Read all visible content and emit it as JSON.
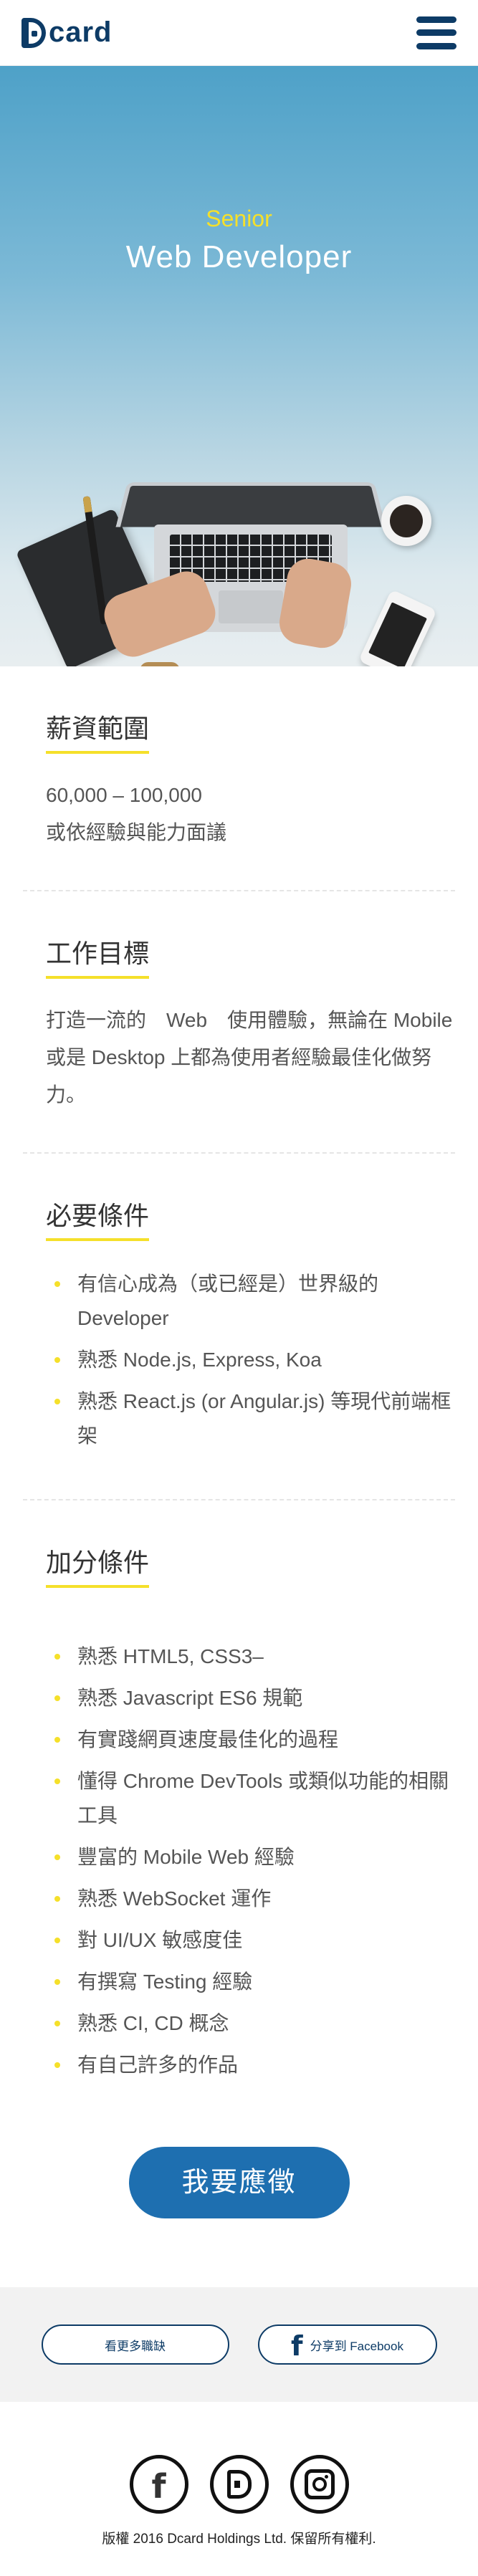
{
  "header": {
    "logo_text": "card",
    "menu_icon": "hamburger-menu-icon"
  },
  "hero": {
    "level": "Senior",
    "title": "Web Developer"
  },
  "salary": {
    "title": "薪資範圍",
    "range": "60,000 – 100,000",
    "note": "或依經驗與能力面議"
  },
  "goal": {
    "title": "工作目標",
    "text": "打造一流的　Web　使用體驗，無論在 Mobile 或是 Desktop 上都為使用者經驗最佳化做努力。"
  },
  "required": {
    "title": "必要條件",
    "items": [
      "有信心成為（或已經是）世界級的 Developer",
      "熟悉 Node.js, Express, Koa",
      "熟悉 React.js (or Angular.js) 等現代前端框架"
    ]
  },
  "bonus": {
    "title": "加分條件",
    "items": [
      "熟悉 HTML5, CSS3–",
      "熟悉 Javascript ES6 規範",
      "有實踐網頁速度最佳化的過程",
      "懂得 Chrome DevTools 或類似功能的相關工具",
      "豐富的 Mobile Web 經驗",
      "熟悉 WebSocket 運作",
      "對 UI/UX 敏感度佳",
      "有撰寫 Testing 經驗",
      "熟悉 CI, CD 概念",
      "有自己許多的作品"
    ]
  },
  "apply_label": "我要應徵",
  "share": {
    "more_jobs": "看更多職缺",
    "facebook": "分享到 Facebook"
  },
  "footer": {
    "copyright": "版權 2016 Dcard Holdings Ltd. 保留所有權利."
  },
  "colors": {
    "brand": "#0d3b66",
    "accent": "#f5e02a",
    "apply": "#1e6fb0"
  }
}
